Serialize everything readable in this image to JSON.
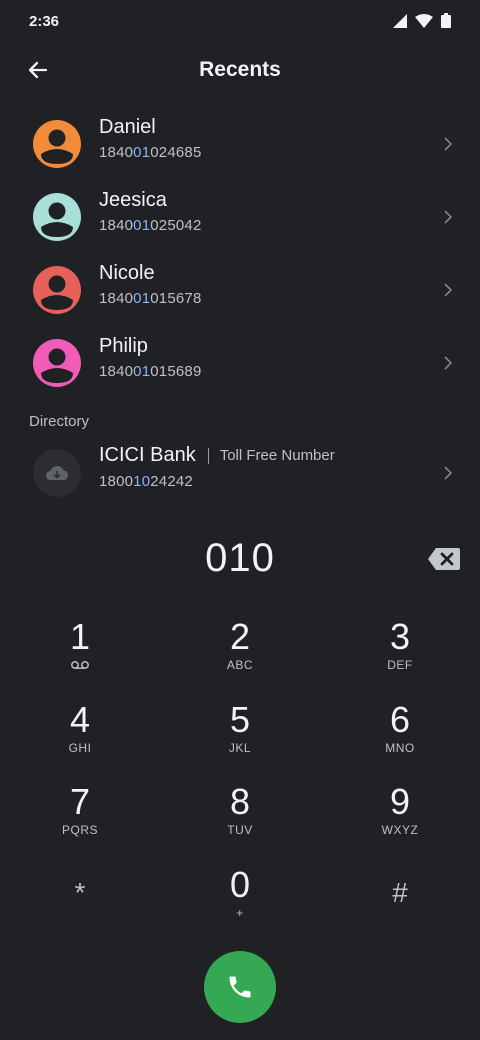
{
  "status_bar": {
    "time": "2:36",
    "icons": [
      "signal-icon",
      "wifi-icon",
      "battery-icon"
    ]
  },
  "app_bar": {
    "title": "Recents",
    "back_icon": "arrow-back-icon"
  },
  "recents": [
    {
      "name": "Daniel",
      "number_pre": "1840",
      "number_match": "01",
      "number_post": "024685",
      "avatar_color": "#f28b3c"
    },
    {
      "name": "Jeesica",
      "number_pre": "1840",
      "number_match": "01",
      "number_post": "025042",
      "avatar_color": "#a8dfd9"
    },
    {
      "name": "Nicole",
      "number_pre": "1840",
      "number_match": "01",
      "number_post": "015678",
      "avatar_color": "#e8605a"
    },
    {
      "name": "Philip",
      "number_pre": "1840",
      "number_match": "01",
      "number_post": "015689",
      "avatar_color": "#f25bb8"
    }
  ],
  "directory": {
    "section_label": "Directory",
    "items": [
      {
        "name": "ICICI Bank",
        "subtitle": "Toll Free Number",
        "number_pre": "1800",
        "number_match": "10",
        "number_post": "24242",
        "icon": "cloud-icon"
      }
    ]
  },
  "dialpad": {
    "entered": "010",
    "backspace_icon": "backspace-icon",
    "keys": [
      {
        "digit": "1",
        "letters": "",
        "icon": "voicemail-icon"
      },
      {
        "digit": "2",
        "letters": "ABC"
      },
      {
        "digit": "3",
        "letters": "DEF"
      },
      {
        "digit": "4",
        "letters": "GHI"
      },
      {
        "digit": "5",
        "letters": "JKL"
      },
      {
        "digit": "6",
        "letters": "MNO"
      },
      {
        "digit": "7",
        "letters": "PQRS"
      },
      {
        "digit": "8",
        "letters": "TUV"
      },
      {
        "digit": "9",
        "letters": "WXYZ"
      },
      {
        "digit": "*",
        "letters": ""
      },
      {
        "digit": "0",
        "letters": "+"
      },
      {
        "digit": "#",
        "letters": ""
      }
    ]
  },
  "call_button": {
    "icon": "phone-icon",
    "color": "#34a853"
  },
  "colors": {
    "background": "#202124",
    "highlight": "#8ab4f8",
    "text": "#f1f3f4",
    "secondary_text": "#bdc1c6"
  }
}
